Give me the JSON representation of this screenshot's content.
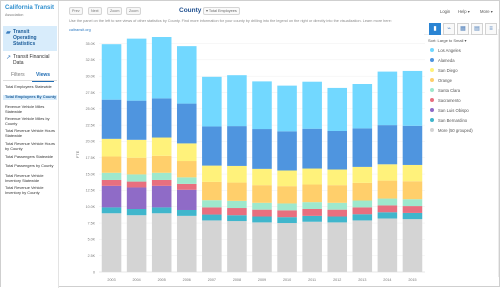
{
  "logo": {
    "title": "California Transit",
    "subtitle": "Association"
  },
  "nav": {
    "primary": "Transit Operating Statistics",
    "secondary": "Transit Financial Data"
  },
  "tabs": [
    "Filters",
    "Views"
  ],
  "metrics": [
    "Total Employees Statewide",
    "Total Employees By County",
    "Revenue Vehicle Miles Statewide",
    "Revenue Vehicle Miles by County",
    "Total Revenue Vehicle Hours Statewide",
    "Total Revenue Vehicle Hours by County",
    "Total Passengers Statewide",
    "Total Passengers by County",
    "Total Revenue Vehicle Inventory Statewide",
    "Total Revenue Vehicle Inventory by County"
  ],
  "header": {
    "back": "Prev",
    "forward": "Next",
    "zoom_out": "Zoom",
    "zoom_in": "Zoom",
    "title": "County",
    "filter_chip": "Total Employees",
    "subtext": "Use the panel on the left to see views of other statistics by County. Find more information for your county by drilling into the legend on the right or directly into the visualization. Learn more here:",
    "link": "caltransit.org"
  },
  "topRight": {
    "login": "Login",
    "help": "Help",
    "more": "More",
    "sort": "Sort: Large to Small"
  },
  "legend": [
    {
      "label": "Los Angeles",
      "color": "#72d8ff"
    },
    {
      "label": "Alameda",
      "color": "#4f95df"
    },
    {
      "label": "San Diego",
      "color": "#fff27b"
    },
    {
      "label": "Orange",
      "color": "#ffcf6b"
    },
    {
      "label": "Santa Clara",
      "color": "#9ee8cd"
    },
    {
      "label": "Sacramento",
      "color": "#e86f7f"
    },
    {
      "label": "San Luis Obispo",
      "color": "#8f6bc7"
    },
    {
      "label": "San Bernardino",
      "color": "#40b6cc"
    },
    {
      "label": "More (50 grouped)",
      "color": "#d4d4d4"
    }
  ],
  "chart_data": {
    "type": "bar",
    "stacked": true,
    "categories": [
      "2003",
      "2004",
      "2005",
      "2006",
      "2007",
      "2008",
      "2009",
      "2010",
      "2011",
      "2012",
      "2013",
      "2014",
      "2015"
    ],
    "y_label": "FTE",
    "y_ticks": [
      "0",
      "2.5K",
      "5.0K",
      "7.5K",
      "10.0K",
      "12.5K",
      "15.0K",
      "17.5K",
      "20.0K",
      "22.5K",
      "25.0K",
      "27.5K",
      "30.0K",
      "32.5K",
      "35.0K"
    ],
    "ylim": [
      0,
      36000
    ],
    "series": [
      {
        "name": "More (50 grouped)",
        "color": "#d4d4d4",
        "values": [
          9000,
          8700,
          9000,
          8600,
          7900,
          7800,
          7600,
          7500,
          7700,
          7600,
          7900,
          8200,
          8100
        ]
      },
      {
        "name": "San Bernardino",
        "color": "#40b6cc",
        "values": [
          900,
          950,
          900,
          900,
          900,
          900,
          900,
          900,
          900,
          900,
          950,
          950,
          950
        ]
      },
      {
        "name": "San Luis Obispo",
        "color": "#8f6bc7",
        "values": [
          3300,
          3300,
          3300,
          3100,
          0,
          0,
          0,
          0,
          0,
          0,
          0,
          0,
          0
        ]
      },
      {
        "name": "Sacramento",
        "color": "#e86f7f",
        "values": [
          900,
          900,
          900,
          900,
          1100,
          1100,
          1050,
          1050,
          1050,
          1050,
          1050,
          1050,
          1050
        ]
      },
      {
        "name": "Santa Clara",
        "color": "#9ee8cd",
        "values": [
          1100,
          1100,
          1100,
          1000,
          1100,
          1100,
          1050,
          1050,
          1050,
          1050,
          1050,
          1050,
          1050
        ]
      },
      {
        "name": "Orange",
        "color": "#ffcf6b",
        "values": [
          2500,
          2550,
          2600,
          2500,
          2800,
          2800,
          2700,
          2650,
          2700,
          2700,
          2700,
          2750,
          2750
        ]
      },
      {
        "name": "San Diego",
        "color": "#fff27b",
        "values": [
          2700,
          2750,
          2800,
          2700,
          2500,
          2550,
          2500,
          2400,
          2450,
          2400,
          2450,
          2500,
          2500
        ]
      },
      {
        "name": "Alameda",
        "color": "#4f95df",
        "values": [
          6000,
          6000,
          6000,
          6100,
          6000,
          6100,
          6100,
          6000,
          6100,
          5900,
          5900,
          6000,
          6000
        ]
      },
      {
        "name": "Los Angeles",
        "color": "#72d8ff",
        "values": [
          8500,
          9500,
          9800,
          8800,
          7600,
          7800,
          7300,
          7000,
          7200,
          6600,
          6800,
          8200,
          8400
        ]
      }
    ]
  }
}
